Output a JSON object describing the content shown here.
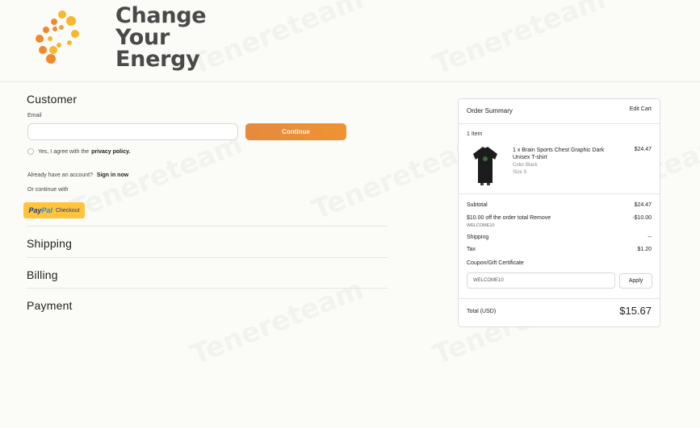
{
  "brand": {
    "logo_lines": [
      "Change",
      "Your",
      "Energy"
    ],
    "colors": {
      "orange": "#f0882e",
      "yellow": "#f5b82e",
      "text": "#4a4a4a"
    }
  },
  "watermark": "Tenereteam",
  "customer": {
    "title": "Customer",
    "email_label": "Email",
    "email_value": "",
    "continue_label": "Continue",
    "agree_prefix": "Yes, I agree with the",
    "agree_link": "privacy policy.",
    "account_prefix": "Already have an account?",
    "account_link": "Sign in now",
    "continue_with": "Or continue with",
    "paypal_pay": "Pay",
    "paypal_pal": "Pal",
    "paypal_checkout": "Checkout"
  },
  "sections": {
    "shipping": "Shipping",
    "billing": "Billing",
    "payment": "Payment"
  },
  "summary": {
    "title": "Order Summary",
    "edit_cart": "Edit Cart",
    "item_count": "1 Item",
    "product": {
      "name": "1 x Brain Sports Chest Graphic Dark Unisex T-shirt",
      "color": "Color Black",
      "size": "Size S",
      "price": "$24.47"
    },
    "subtotal_label": "Subtotal",
    "subtotal_value": "$24.47",
    "discount_label": "$10.00 off the order total Remove",
    "discount_value": "-$10.00",
    "discount_code": "WELCOME10",
    "shipping_label": "Shipping",
    "shipping_value": "--",
    "tax_label": "Tax",
    "tax_value": "$1.20",
    "coupon_label": "Coupon/Gift Certificate",
    "coupon_value": "WELCOME10",
    "apply_label": "Apply",
    "total_label": "Total (USD)",
    "total_value": "$15.67"
  }
}
